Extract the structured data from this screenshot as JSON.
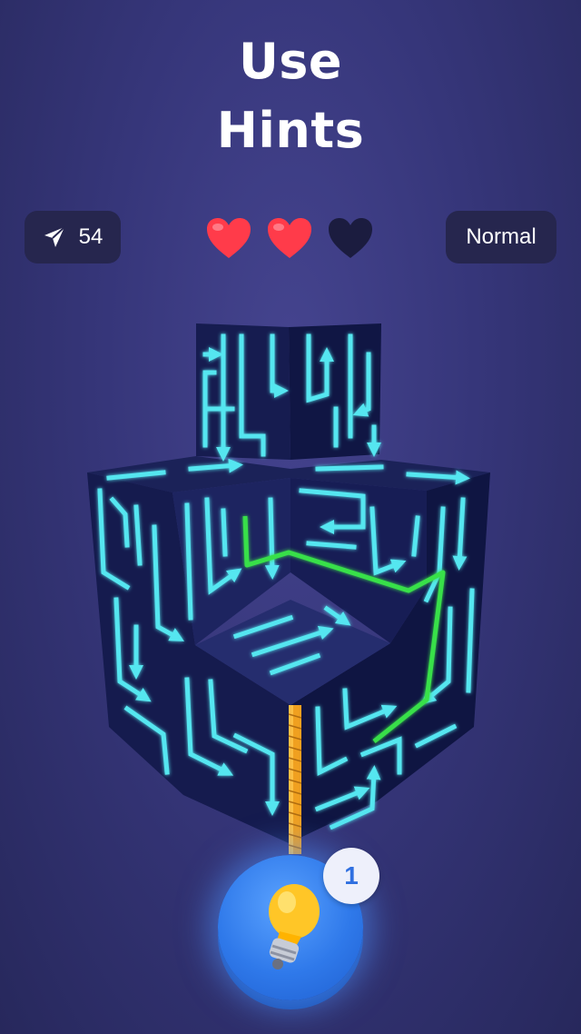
{
  "header": {
    "title_line1": "Use",
    "title_line2": "Hints"
  },
  "stats": {
    "moves": "54",
    "moves_icon": "paper-plane-icon",
    "difficulty": "Normal"
  },
  "lives": {
    "total": 3,
    "remaining": 2,
    "full_color": "#ff3b4a",
    "empty_color": "#1b1c3f"
  },
  "hint": {
    "count": "1",
    "icon": "light-bulb-icon"
  },
  "colors": {
    "maze_line": "#54e6f0",
    "maze_face": "#141a4a",
    "hint_path": "#39e04a",
    "snake": "#f0a020"
  }
}
